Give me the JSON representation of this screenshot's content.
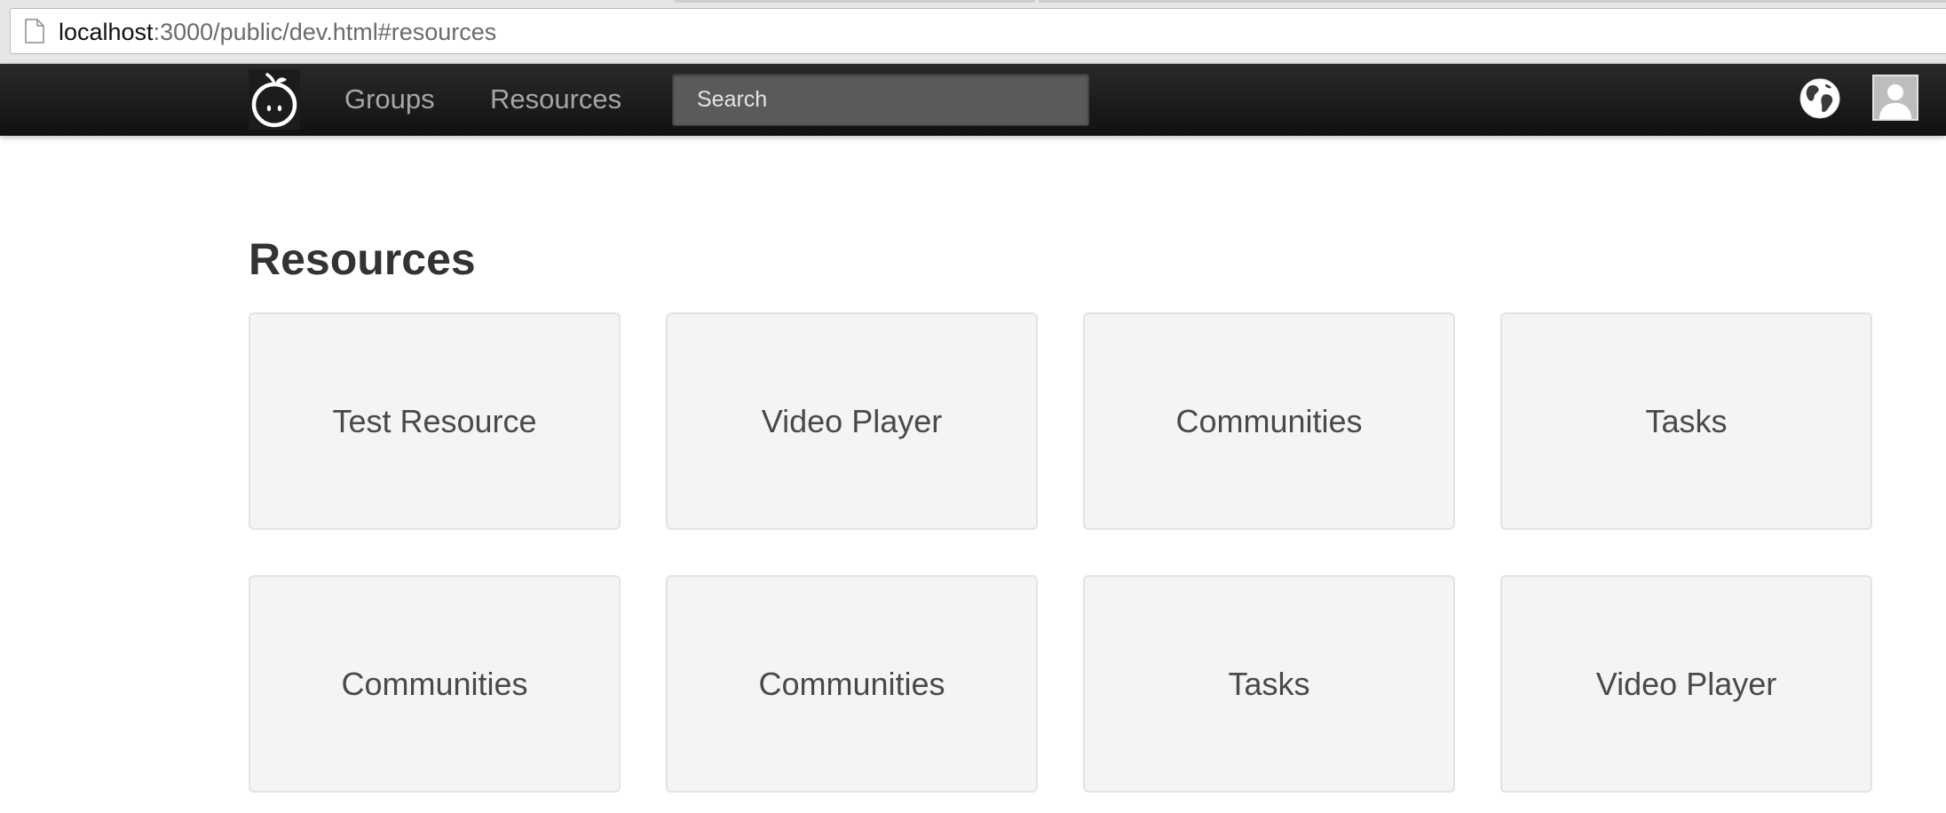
{
  "browser": {
    "url_host": "localhost",
    "url_rest": ":3000/public/dev.html#resources",
    "page_icon": "document-icon"
  },
  "navbar": {
    "logo_icon": "apple-face-logo",
    "links": [
      {
        "label": "Groups"
      },
      {
        "label": "Resources"
      }
    ],
    "search_placeholder": "Search",
    "globe_icon": "globe-icon",
    "avatar_icon": "user-avatar-icon",
    "colors": {
      "bar": "#111111",
      "link": "#a6a6a6",
      "search_bg": "#5a5a5a"
    }
  },
  "main": {
    "title": "Resources",
    "cards": [
      {
        "label": "Test Resource"
      },
      {
        "label": "Video Player"
      },
      {
        "label": "Communities"
      },
      {
        "label": "Tasks"
      },
      {
        "label": "Communities"
      },
      {
        "label": "Communities"
      },
      {
        "label": "Tasks"
      },
      {
        "label": "Video Player"
      }
    ],
    "colors": {
      "card_bg": "#f4f4f4",
      "card_border": "#e3e3e3",
      "title": "#333333"
    }
  }
}
